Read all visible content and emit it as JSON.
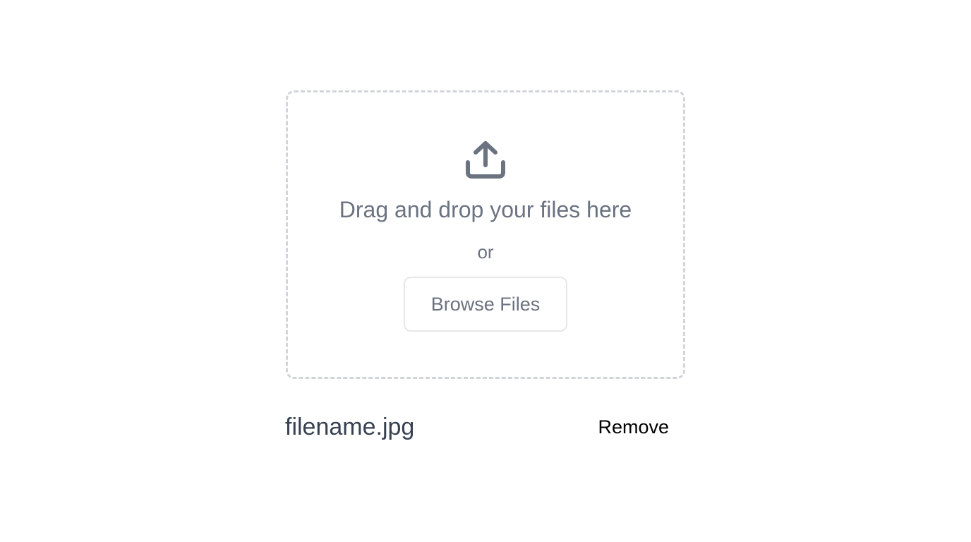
{
  "upload": {
    "icon": "upload-icon",
    "drop_text": "Drag and drop your files here",
    "or_text": "or",
    "browse_label": "Browse Files"
  },
  "file": {
    "name": "filename.jpg",
    "remove_label": "Remove"
  },
  "colors": {
    "text_muted": "#6b7280",
    "text_dark": "#374151",
    "dash_border": "#d1d5db",
    "button_border": "#e5e7eb"
  }
}
